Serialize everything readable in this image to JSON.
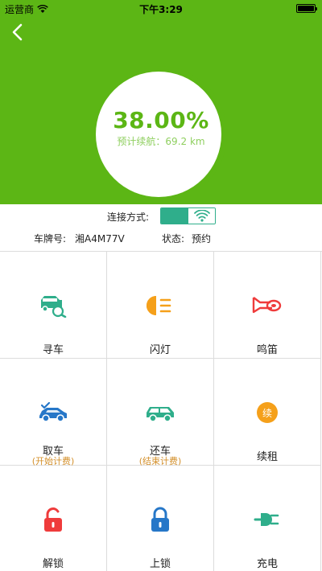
{
  "status_bar": {
    "carrier": "运营商",
    "time": "下午3:29"
  },
  "battery_gauge": {
    "percent_text": "38.00%",
    "level": 0.38,
    "range_label": "预计续航：",
    "range_value": "69.2 km"
  },
  "connection": {
    "label": "连接方式:",
    "selected": "wifi"
  },
  "vehicle": {
    "plate_label": "车牌号:",
    "plate_value": "湘A4M77V",
    "status_label": "状态:",
    "status_value": "预约"
  },
  "actions": [
    {
      "label": "寻车",
      "icon": "find-car-icon"
    },
    {
      "label": "闪灯",
      "icon": "headlight-icon"
    },
    {
      "label": "鸣笛",
      "icon": "horn-icon"
    },
    {
      "label": "取车",
      "sub": "(开始计费)",
      "icon": "pickup-car-icon"
    },
    {
      "label": "还车",
      "sub": "(结束计费)",
      "icon": "return-car-icon"
    },
    {
      "label": "续租",
      "icon_text": "续",
      "icon": "renew-icon"
    },
    {
      "label": "解锁",
      "icon": "unlock-icon"
    },
    {
      "label": "上锁",
      "icon": "lock-icon"
    },
    {
      "label": "充电",
      "icon": "charge-plug-icon"
    }
  ],
  "colors": {
    "header": "#5cb615",
    "teal": "#2fae8b",
    "orange": "#f5a01a",
    "red": "#ef3b3b",
    "blue": "#2677c8",
    "sub_text": "#d4902b"
  }
}
